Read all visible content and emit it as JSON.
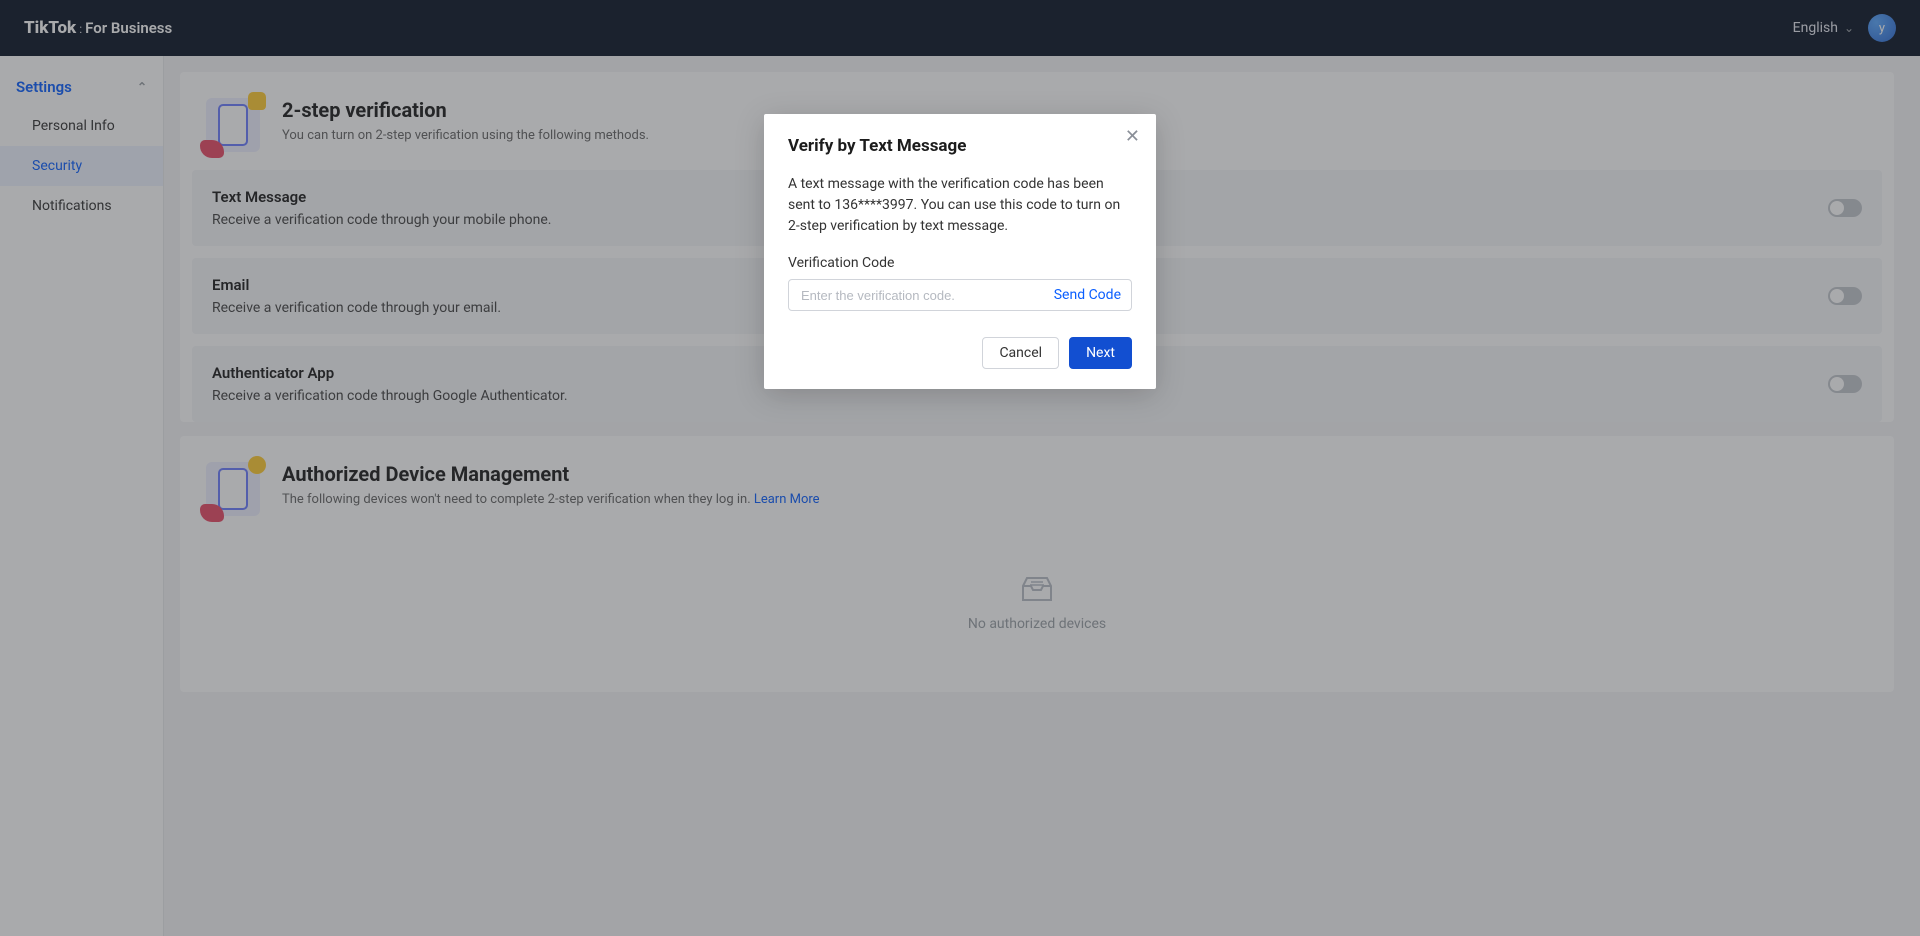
{
  "header": {
    "logo_main": "TikTok",
    "logo_sep": ":",
    "logo_sub": "For Business",
    "language": "English",
    "avatar_letter": "y"
  },
  "sidebar": {
    "heading": "Settings",
    "items": [
      {
        "label": "Personal Info"
      },
      {
        "label": "Security"
      },
      {
        "label": "Notifications"
      }
    ]
  },
  "verification": {
    "title": "2-step verification",
    "desc": "You can turn on 2-step verification using the following methods.",
    "methods": [
      {
        "title": "Text Message",
        "desc": "Receive a verification code through your mobile phone."
      },
      {
        "title": "Email",
        "desc": "Receive a verification code through your email."
      },
      {
        "title": "Authenticator App",
        "desc": "Receive a verification code through Google Authenticator."
      }
    ]
  },
  "devices": {
    "title": "Authorized Device Management",
    "desc": "The following devices won't need to complete 2-step verification when they log in. ",
    "learn_more": "Learn More",
    "empty": "No authorized devices"
  },
  "modal": {
    "title": "Verify by Text Message",
    "body": "A text message with the verification code has been sent to 136****3997. You can use this code to turn on 2-step verification by text message.",
    "label": "Verification Code",
    "placeholder": "Enter the verification code.",
    "send_code": "Send Code",
    "cancel": "Cancel",
    "next": "Next"
  }
}
